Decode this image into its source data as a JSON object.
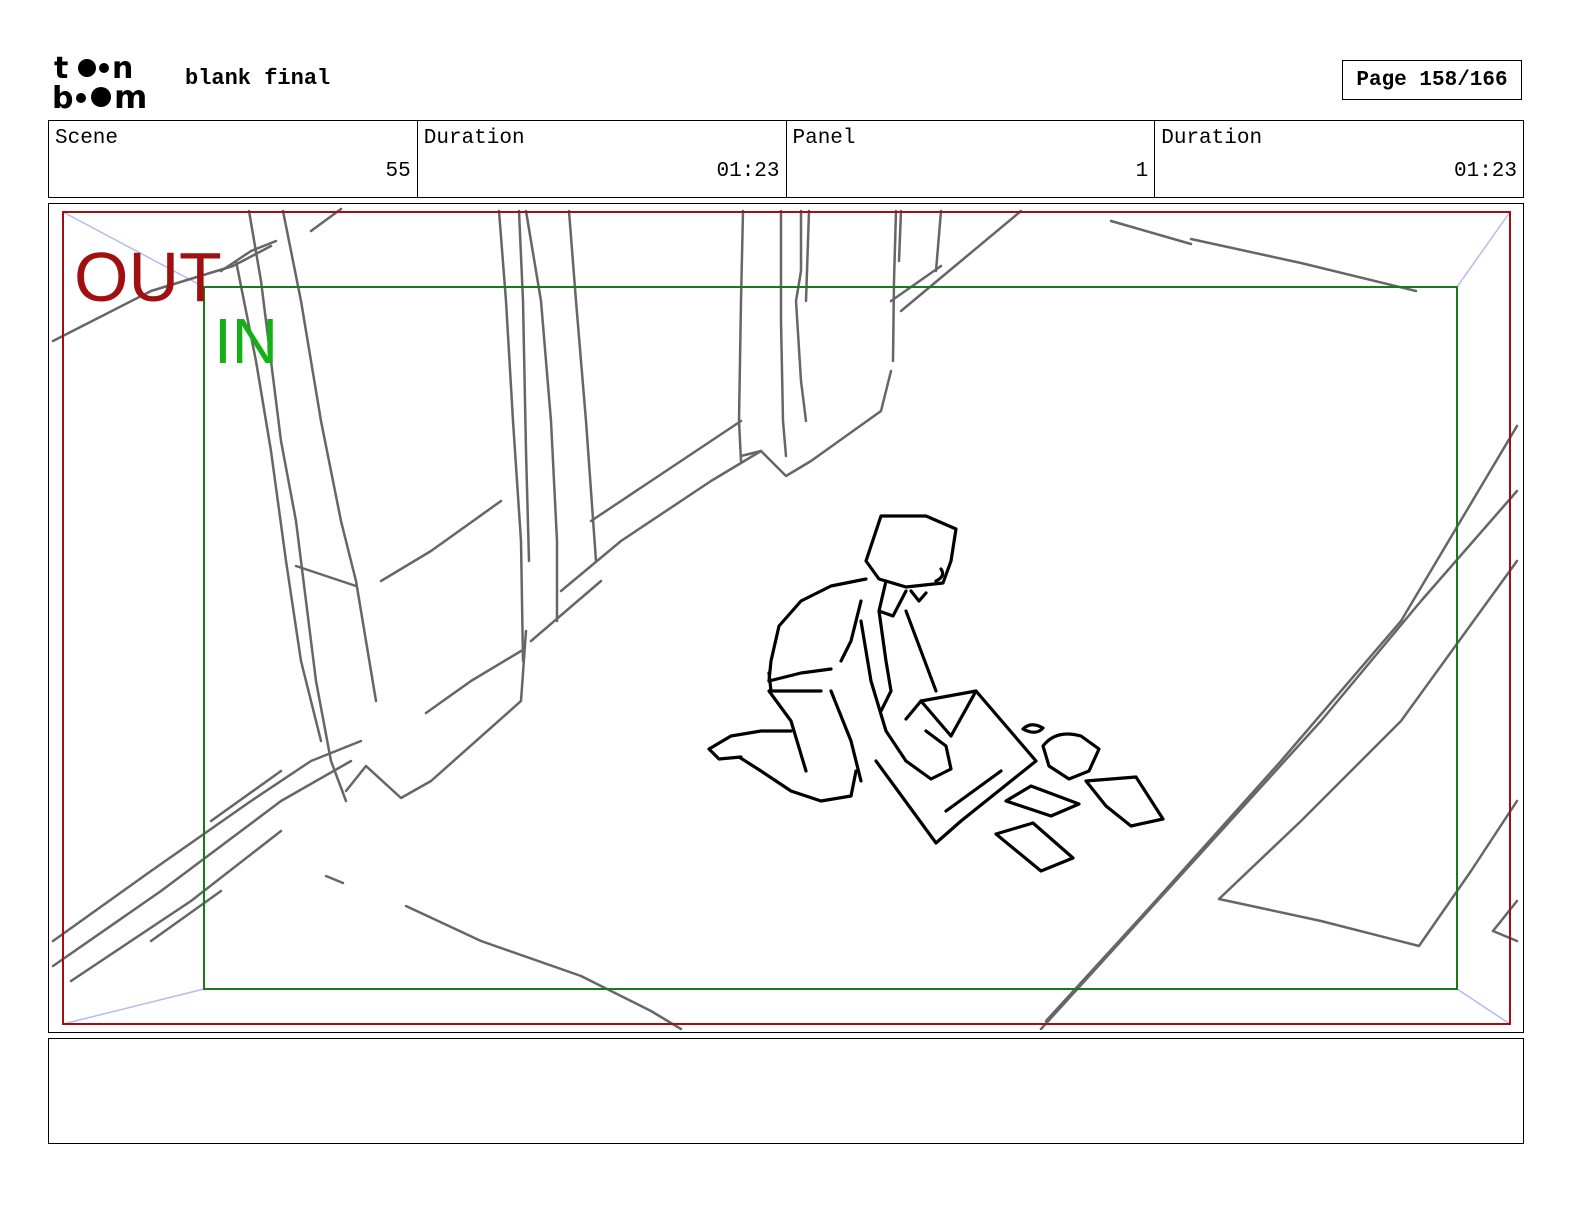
{
  "header": {
    "logo_text_top": "toon",
    "logo_text_bottom": "boom",
    "project_title": "blank final",
    "page_label": "Page 158/166"
  },
  "info": [
    {
      "label": "Scene",
      "value": "55"
    },
    {
      "label": "Duration",
      "value": "01:23"
    },
    {
      "label": "Panel",
      "value": "1"
    },
    {
      "label": "Duration",
      "value": "01:23"
    }
  ],
  "panel": {
    "out_label": "OUT",
    "in_label": "IN",
    "colors": {
      "out_frame": "#a01010",
      "in_frame": "#1a7a1a",
      "in_text": "#14b014",
      "sketch_gray": "#666666",
      "character": "#000000",
      "corner_guides": "#b8b8f0"
    }
  },
  "notes": {
    "text": ""
  }
}
